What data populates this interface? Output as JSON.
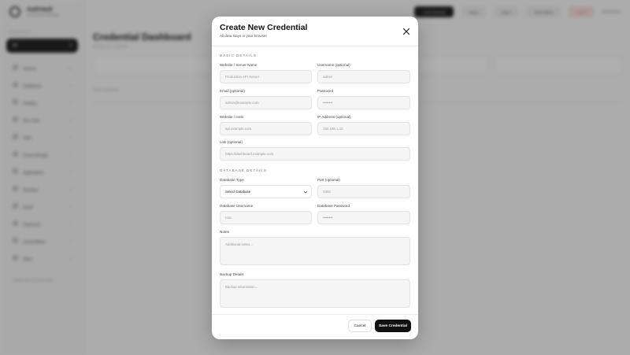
{
  "background": {
    "brand_name": "AuthVault",
    "brand_sub": "Local Secrets Manager",
    "workspace_label": "WORKSPACE",
    "workspace_name": "All",
    "sidebar_items": [
      {
        "label": "Servers",
        "count": "12"
      },
      {
        "label": "Databases",
        "count": "8"
      },
      {
        "label": "Hosting",
        "count": "5"
      },
      {
        "label": "Dev Tools",
        "count": "4"
      },
      {
        "label": "VPN",
        "count": "2"
      },
      {
        "label": "Cloud Storage",
        "count": "3"
      },
      {
        "label": "Applications",
        "count": "6"
      },
      {
        "label": "Domains",
        "count": "4"
      },
      {
        "label": "Email",
        "count": "2"
      },
      {
        "label": "Payments",
        "count": "1"
      },
      {
        "label": "Social Media",
        "count": "3"
      },
      {
        "label": "Other",
        "count": "0"
      }
    ],
    "sidebar_footer": "Vaulted data is stored locally",
    "topbar_buttons": [
      "+ Add Credential",
      "Import",
      "Export",
      "Show Hidden",
      "Logout"
    ],
    "user": "Administrator",
    "dashboard_title": "Credential Dashboard",
    "dashboard_sub": "Manage your credentials",
    "table_title": "Saved Credentials"
  },
  "modal": {
    "title": "Create New Credential",
    "description": "All data stays in your browser",
    "sections": {
      "basic": "BASIC DETAILS",
      "database": "DATABASE DETAILS"
    },
    "fields": {
      "website_name": {
        "label": "Website / Server Name",
        "placeholder": "Production API Server"
      },
      "username": {
        "label": "Username (optional)",
        "placeholder": "admin"
      },
      "email": {
        "label": "Email (optional)",
        "placeholder": "admin@example.com"
      },
      "password": {
        "label": "Password",
        "placeholder": "••••••••"
      },
      "website_host": {
        "label": "Website / Host",
        "placeholder": "api.example.com"
      },
      "ip_address": {
        "label": "IP Address (optional)",
        "placeholder": "192.168.1.10"
      },
      "link": {
        "label": "Link (optional)",
        "placeholder": "https://dashboard.example.com"
      },
      "database_type": {
        "label": "Database Type",
        "value": "Select Database"
      },
      "port": {
        "label": "Port (optional)",
        "placeholder": "3306"
      },
      "db_username": {
        "label": "Database Username",
        "placeholder": "root"
      },
      "db_password": {
        "label": "Database Password",
        "placeholder": "••••••••"
      },
      "notes": {
        "label": "Notes",
        "placeholder": "Additional notes..."
      },
      "backup": {
        "label": "Backup Details",
        "placeholder": "Backup information..."
      }
    },
    "buttons": {
      "cancel": "Cancel",
      "save": "Save Credential"
    }
  },
  "colors": {
    "primary": "#111111",
    "overlay": "#282828"
  }
}
